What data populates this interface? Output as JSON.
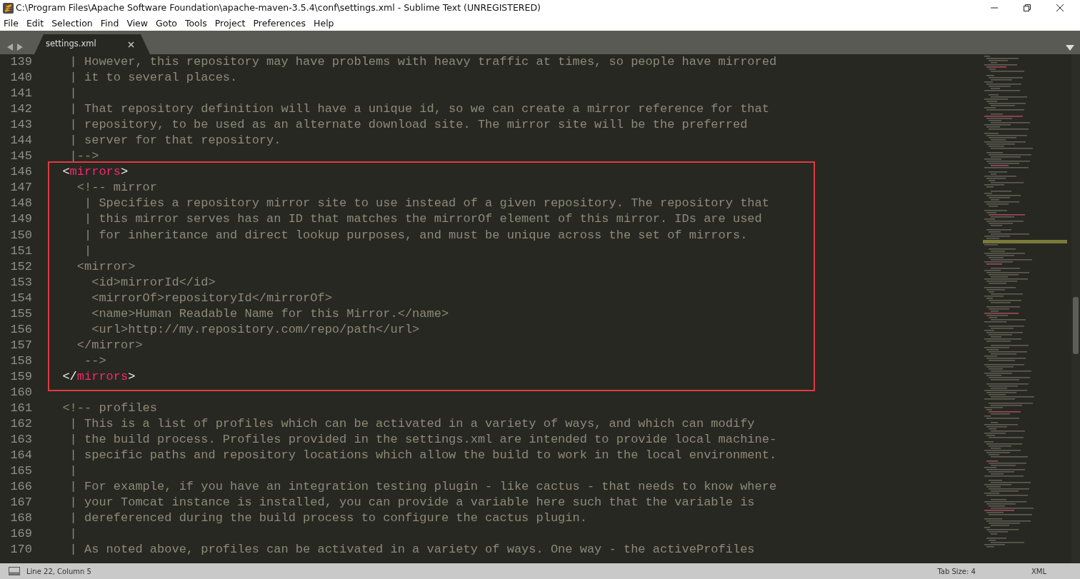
{
  "window": {
    "title": "C:\\Program Files\\Apache Software Foundation\\apache-maven-3.5.4\\conf\\settings.xml - Sublime Text (UNREGISTERED)"
  },
  "menu": [
    "File",
    "Edit",
    "Selection",
    "Find",
    "View",
    "Goto",
    "Tools",
    "Project",
    "Preferences",
    "Help"
  ],
  "tabs": [
    {
      "label": "settings.xml",
      "selected": true
    }
  ],
  "editor": {
    "blocks": [
      {
        "highlighted": false,
        "lines": [
          {
            "number": "139",
            "tokens": [
              {
                "kind": "comment",
                "text": "   | However, this repository may have problems with heavy traffic at times, so people have mirrored"
              }
            ]
          },
          {
            "number": "140",
            "tokens": [
              {
                "kind": "comment",
                "text": "   | it to several places."
              }
            ]
          },
          {
            "number": "141",
            "tokens": [
              {
                "kind": "comment",
                "text": "   |"
              }
            ]
          },
          {
            "number": "142",
            "tokens": [
              {
                "kind": "comment",
                "text": "   | That repository definition will have a unique id, so we can create a mirror reference for that"
              }
            ]
          },
          {
            "number": "143",
            "tokens": [
              {
                "kind": "comment",
                "text": "   | repository, to be used as an alternate download site. The mirror site will be the preferred"
              }
            ]
          },
          {
            "number": "144",
            "tokens": [
              {
                "kind": "comment",
                "text": "   | server for that repository."
              }
            ]
          },
          {
            "number": "145",
            "tokens": [
              {
                "kind": "comment",
                "text": "   |-->"
              }
            ]
          }
        ]
      },
      {
        "highlighted": true,
        "lines": [
          {
            "number": "146",
            "tokens": [
              {
                "kind": "punct",
                "text": "  <"
              },
              {
                "kind": "tag",
                "text": "mirrors"
              },
              {
                "kind": "punct",
                "text": ">"
              }
            ]
          },
          {
            "number": "147",
            "tokens": [
              {
                "kind": "comment",
                "text": "    <!-- mirror"
              }
            ]
          },
          {
            "number": "148",
            "tokens": [
              {
                "kind": "comment",
                "text": "     | Specifies a repository mirror site to use instead of a given repository. The repository that"
              }
            ]
          },
          {
            "number": "149",
            "tokens": [
              {
                "kind": "comment",
                "text": "     | this mirror serves has an ID that matches the mirrorOf element of this mirror. IDs are used"
              }
            ]
          },
          {
            "number": "150",
            "tokens": [
              {
                "kind": "comment",
                "text": "     | for inheritance and direct lookup purposes, and must be unique across the set of mirrors."
              }
            ]
          },
          {
            "number": "151",
            "tokens": [
              {
                "kind": "comment",
                "text": "     |"
              }
            ]
          },
          {
            "number": "152",
            "tokens": [
              {
                "kind": "comment",
                "text": "    <mirror>"
              }
            ]
          },
          {
            "number": "153",
            "tokens": [
              {
                "kind": "comment",
                "text": "      <id>mirrorId</id>"
              }
            ]
          },
          {
            "number": "154",
            "tokens": [
              {
                "kind": "comment",
                "text": "      <mirrorOf>repositoryId</mirrorOf>"
              }
            ]
          },
          {
            "number": "155",
            "tokens": [
              {
                "kind": "comment",
                "text": "      <name>Human Readable Name for this Mirror.</name>"
              }
            ]
          },
          {
            "number": "156",
            "tokens": [
              {
                "kind": "comment",
                "text": "      <url>http://my.repository.com/repo/path</url>"
              }
            ]
          },
          {
            "number": "157",
            "tokens": [
              {
                "kind": "comment",
                "text": "    </mirror>"
              }
            ]
          },
          {
            "number": "158",
            "tokens": [
              {
                "kind": "comment",
                "text": "     -->"
              }
            ]
          },
          {
            "number": "159",
            "tokens": [
              {
                "kind": "punct",
                "text": "  </"
              },
              {
                "kind": "tag",
                "text": "mirrors"
              },
              {
                "kind": "punct",
                "text": ">"
              }
            ]
          }
        ]
      },
      {
        "highlighted": false,
        "lines": [
          {
            "number": "160"
          },
          {
            "number": "161",
            "tokens": [
              {
                "kind": "comment",
                "text": "  <!-- profiles"
              }
            ]
          },
          {
            "number": "162",
            "tokens": [
              {
                "kind": "comment",
                "text": "   | This is a list of profiles which can be activated in a variety of ways, and which can modify"
              }
            ]
          },
          {
            "number": "163",
            "tokens": [
              {
                "kind": "comment",
                "text": "   | the build process. Profiles provided in the settings.xml are intended to provide local machine-"
              }
            ]
          },
          {
            "number": "164",
            "tokens": [
              {
                "kind": "comment",
                "text": "   | specific paths and repository locations which allow the build to work in the local environment."
              }
            ]
          },
          {
            "number": "165",
            "tokens": [
              {
                "kind": "comment",
                "text": "   |"
              }
            ]
          },
          {
            "number": "166",
            "tokens": [
              {
                "kind": "comment",
                "text": "   | For example, if you have an integration testing plugin - like cactus - that needs to know where"
              }
            ]
          },
          {
            "number": "167",
            "tokens": [
              {
                "kind": "comment",
                "text": "   | your Tomcat instance is installed, you can provide a variable here such that the variable is"
              }
            ]
          },
          {
            "number": "168",
            "tokens": [
              {
                "kind": "comment",
                "text": "   | dereferenced during the build process to configure the cactus plugin."
              }
            ]
          },
          {
            "number": "169",
            "tokens": [
              {
                "kind": "comment",
                "text": "   |"
              }
            ]
          },
          {
            "number": "170",
            "tokens": [
              {
                "kind": "comment",
                "text": "   | As noted above, profiles can be activated in a variety of ways. One way - the activeProfiles"
              }
            ]
          }
        ]
      }
    ]
  },
  "status_bar": {
    "position": "Line 22, Column 5",
    "tab_size": "Tab Size: 4",
    "syntax": "XML"
  }
}
